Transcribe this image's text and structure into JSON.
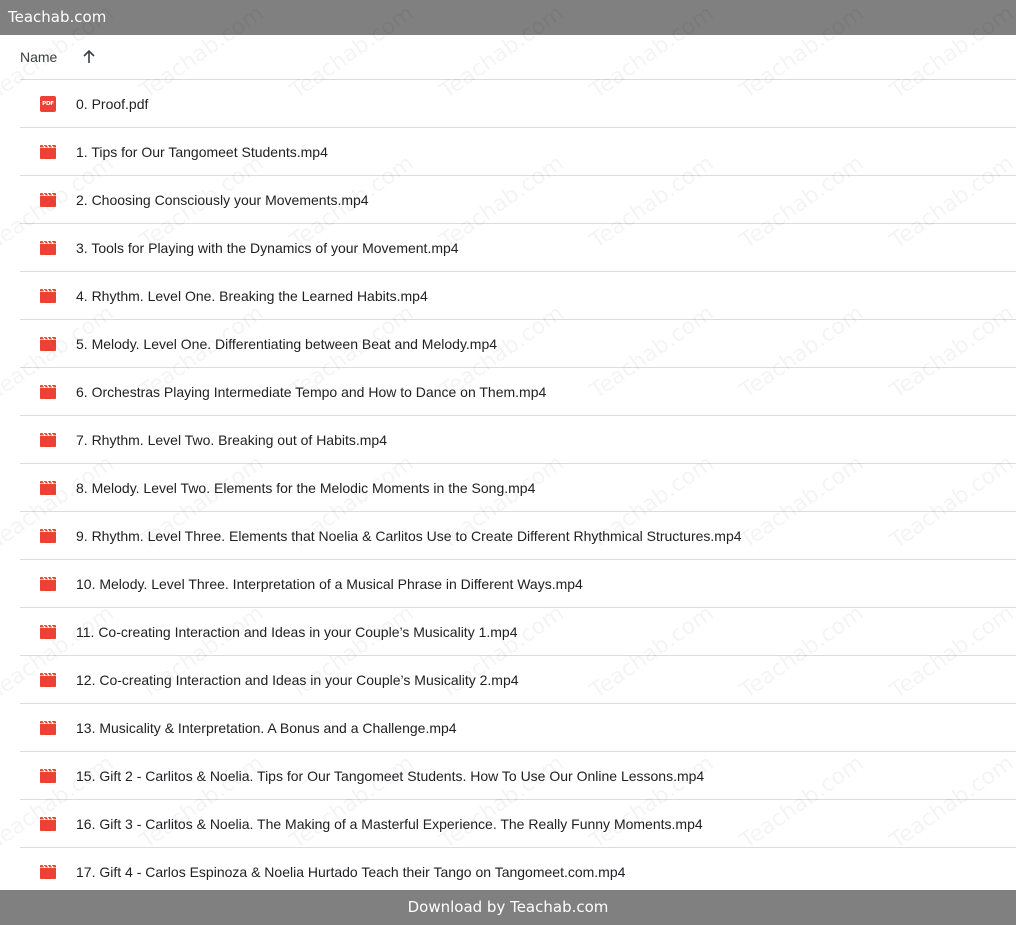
{
  "site": {
    "title": "Teachab.com",
    "footer": "Download by Teachab.com",
    "watermark": "Teachab.com"
  },
  "header": {
    "name_label": "Name"
  },
  "colors": {
    "bar": "#808080",
    "icon_red": "#ea4335",
    "divider": "#dadce0"
  },
  "pdf_icon_text": "PDF",
  "files": [
    {
      "name": "0. Proof.pdf",
      "icon": "pdf-icon"
    },
    {
      "name": "1. Tips for Our Tangomeet Students.mp4",
      "icon": "video-icon"
    },
    {
      "name": "2. Choosing Consciously your Movements.mp4",
      "icon": "video-icon"
    },
    {
      "name": "3. Tools for Playing with the Dynamics of your Movement.mp4",
      "icon": "video-icon"
    },
    {
      "name": "4. Rhythm. Level One. Breaking the Learned Habits.mp4",
      "icon": "video-icon"
    },
    {
      "name": "5. Melody. Level One. Differentiating between Beat and Melody.mp4",
      "icon": "video-icon"
    },
    {
      "name": "6. Orchestras Playing Intermediate Tempo and How to Dance on Them.mp4",
      "icon": "video-icon"
    },
    {
      "name": "7. Rhythm. Level Two. Breaking out of Habits.mp4",
      "icon": "video-icon"
    },
    {
      "name": "8. Melody. Level Two. Elements for the Melodic Moments in the Song.mp4",
      "icon": "video-icon"
    },
    {
      "name": "9. Rhythm. Level Three. Elements that Noelia & Carlitos Use to Create Different Rhythmical Structures.mp4",
      "icon": "video-icon"
    },
    {
      "name": "10. Melody. Level Three. Interpretation of a Musical Phrase in Different Ways.mp4",
      "icon": "video-icon"
    },
    {
      "name": "11. Co-creating Interaction and Ideas in your Couple’s Musicality 1.mp4",
      "icon": "video-icon"
    },
    {
      "name": "12. Co-creating Interaction and Ideas in your Couple’s Musicality 2.mp4",
      "icon": "video-icon"
    },
    {
      "name": "13. Musicality & Interpretation. A Bonus and a Challenge.mp4",
      "icon": "video-icon"
    },
    {
      "name": "15. Gift 2 - Carlitos & Noelia. Tips for Our Tangomeet Students. How To Use Our Online Lessons.mp4",
      "icon": "video-icon"
    },
    {
      "name": "16. Gift 3 - Carlitos & Noelia. The Making of a Masterful Experience. The Really Funny Moments.mp4",
      "icon": "video-icon"
    },
    {
      "name": "17. Gift 4 - Carlos Espinoza & Noelia Hurtado Teach their Tango on Tangomeet.com.mp4",
      "icon": "video-icon"
    }
  ]
}
